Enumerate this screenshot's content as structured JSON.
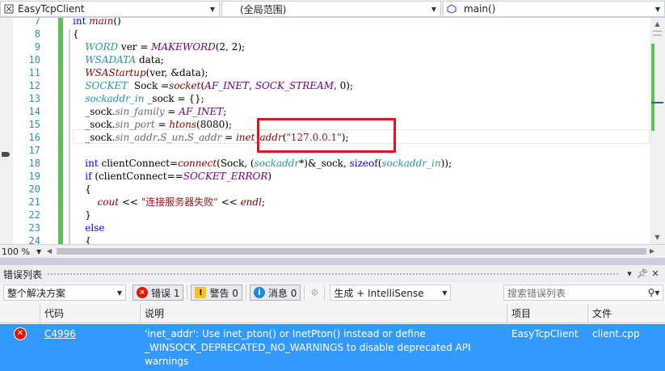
{
  "navbar": {
    "project": "EasyTcpClient",
    "scope": "(全局范围)",
    "member": "main()"
  },
  "editor": {
    "line_numbers": [
      "7",
      "8",
      "9",
      "10",
      "11",
      "12",
      "13",
      "14",
      "15",
      "16",
      "17",
      "18",
      "19",
      "20",
      "21",
      "22",
      "23",
      "24"
    ],
    "zoom": "100 %"
  },
  "error_list": {
    "title": "错误列表",
    "scope_filter": "整个解决方案",
    "errors_label": "错误 1",
    "warnings_label": "警告 0",
    "messages_label": "消息 0",
    "build_filter": "生成 + IntelliSense",
    "search_placeholder": "搜索错误列表",
    "columns": {
      "code": "代码",
      "description": "说明",
      "project": "项目",
      "file": "文件"
    },
    "rows": [
      {
        "code": "C4996",
        "description": "'inet_addr': Use inet_pton() or InetPton() instead or define _WINSOCK_DEPRECATED_NO_WARNINGS to disable deprecated API warnings",
        "project": "EasyTcpClient",
        "file": "client.cpp"
      }
    ]
  },
  "colors": {
    "selection": "#3399ff",
    "highlight_box": "#e3141b",
    "keyword": "#0000ff",
    "type": "#2b91af",
    "macro": "#6f008a",
    "string": "#a31515",
    "change_bar": "#5fbf5f"
  }
}
